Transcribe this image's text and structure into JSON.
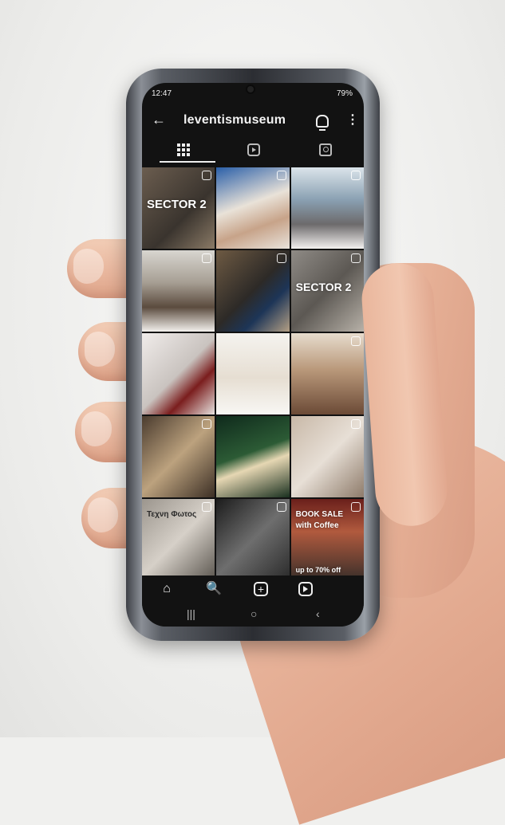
{
  "status": {
    "time": "12:47",
    "battery": "79%"
  },
  "profile": {
    "username": "leventismuseum"
  },
  "nav": {
    "back_glyph": "←",
    "kebab_glyph": "⋮",
    "home_glyph": "⌂",
    "search_glyph": "🔍",
    "plus_glyph": "+",
    "recent_glyph": "|||",
    "homebtn_glyph": "○",
    "backbtn_glyph": "‹"
  },
  "posts": {
    "p0": "SECTOR 2",
    "p5": "SECTOR 2",
    "p12": "Τεχνη Φωτος",
    "p14a": "BOOK SALE",
    "p14b": "with Coffee",
    "p14c": "up to 70% off"
  },
  "colors": {
    "screen_bg": "#121212",
    "text": "#f2f2f2"
  }
}
